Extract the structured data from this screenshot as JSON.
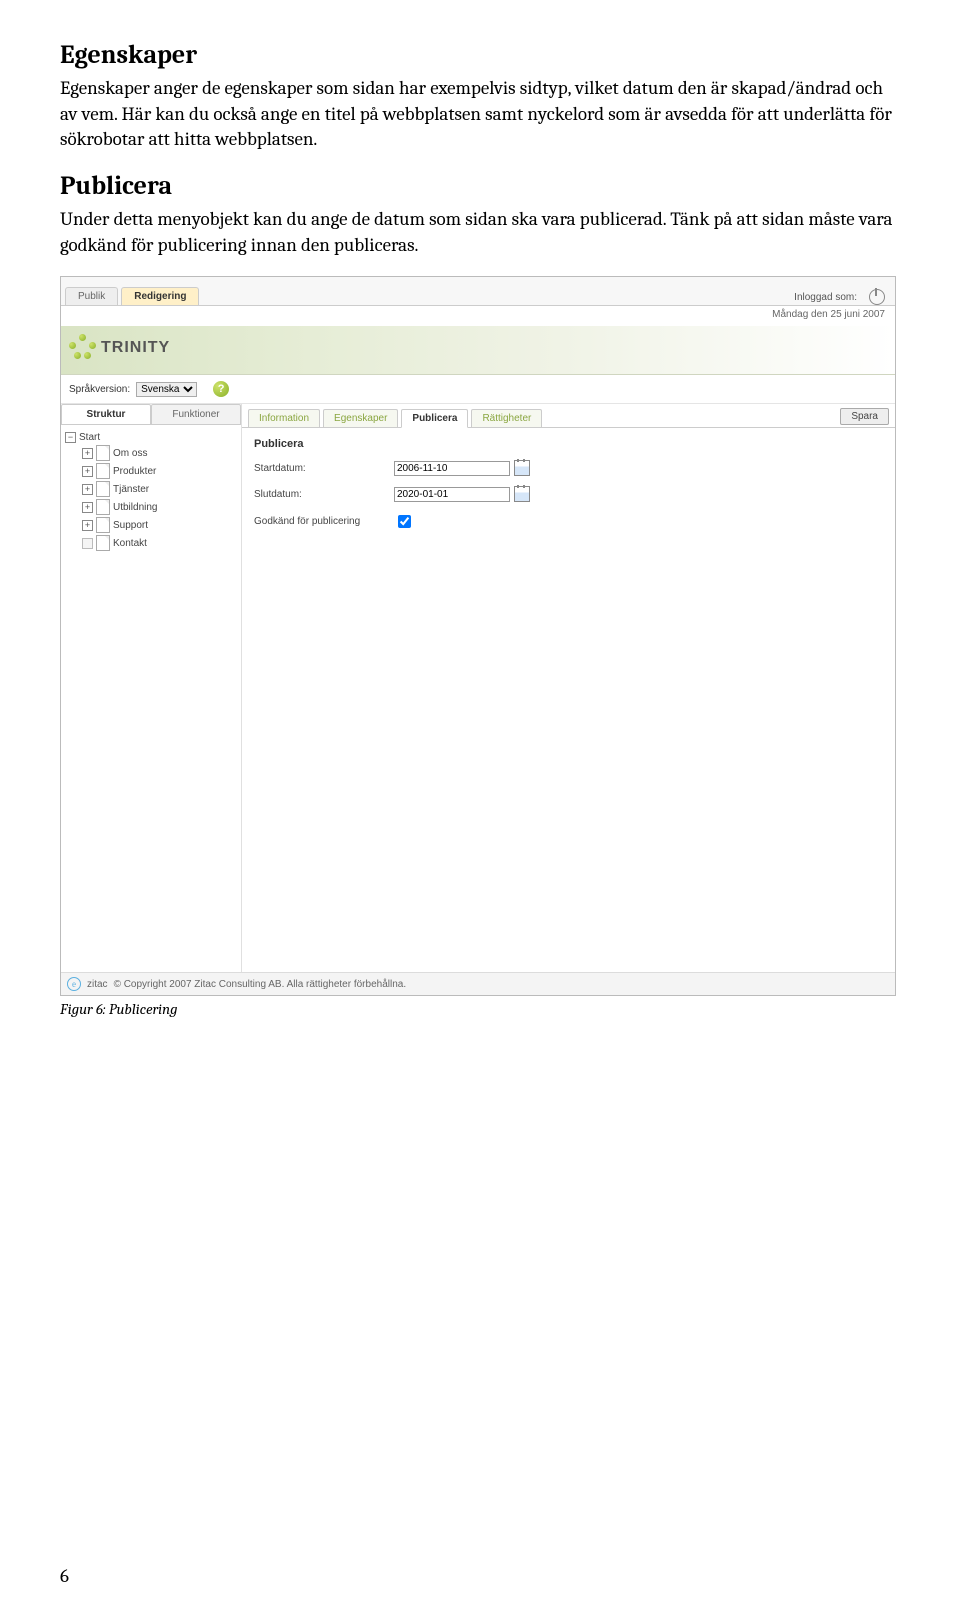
{
  "doc": {
    "h1": "Egenskaper",
    "p1": "Egenskaper anger de egenskaper som sidan har exempelvis sidtyp, vilket datum den är skapad/ändrad och av vem. Här kan du också ange en titel på webbplatsen samt nyckelord som är avsedda för att underlätta för sökrobotar att hitta webbplatsen.",
    "h2": "Publicera",
    "p2": "Under detta menyobjekt kan du ange de datum som sidan ska vara publicerad. Tänk på att sidan måste vara godkänd för publicering innan den publiceras.",
    "caption": "Figur 6: Publicering",
    "page_number": "6"
  },
  "app": {
    "view_tabs": {
      "publik": "Publik",
      "redigering": "Redigering"
    },
    "logged_in_label": "Inloggad som:",
    "date_text": "Måndag den 25 juni 2007",
    "brand": "TRINITY",
    "lang_label": "Språkversion:",
    "lang_value": "Svenska",
    "left_tabs": {
      "struktur": "Struktur",
      "funktioner": "Funktioner"
    },
    "tree": {
      "root": "Start",
      "items": [
        "Om oss",
        "Produkter",
        "Tjänster",
        "Utbildning",
        "Support",
        "Kontakt"
      ]
    },
    "content_tabs": {
      "information": "Information",
      "egenskaper": "Egenskaper",
      "publicera": "Publicera",
      "rattigheter": "Rättigheter"
    },
    "save_label": "Spara",
    "panel": {
      "title": "Publicera",
      "start_label": "Startdatum:",
      "start_value": "2006-11-10",
      "end_label": "Slutdatum:",
      "end_value": "2020-01-01",
      "approved_label": "Godkänd för publicering"
    },
    "footer": {
      "brand": "zitac",
      "text": "© Copyright 2007 Zitac Consulting AB. Alla rättigheter förbehållna."
    }
  }
}
